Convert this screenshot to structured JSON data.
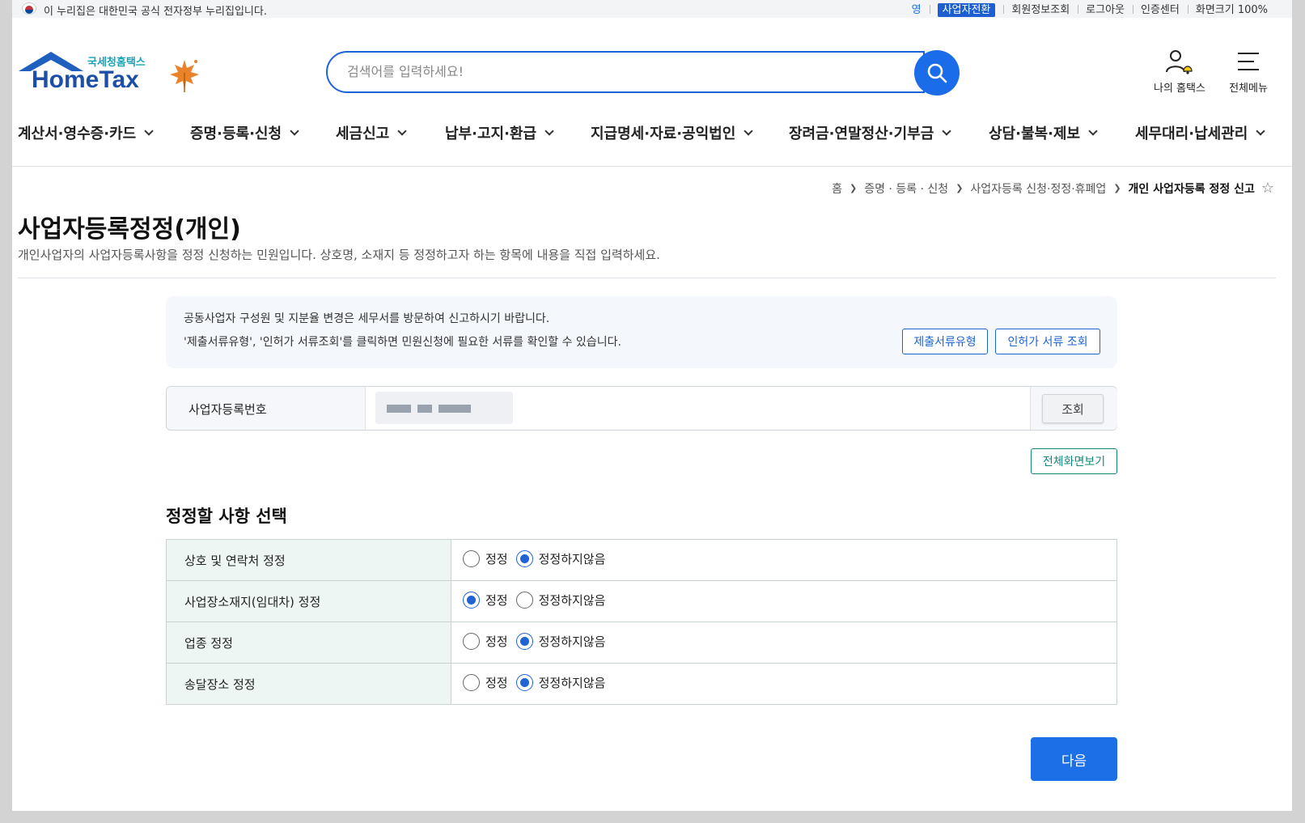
{
  "gov_banner": {
    "text": "이 누리집은 대한민국 공식 전자정부 누리집입니다.",
    "links": [
      {
        "label": "영"
      },
      {
        "label": "사업자전환"
      },
      {
        "label": "회원정보조회"
      },
      {
        "label": "로그아웃"
      },
      {
        "label": "인증센터"
      },
      {
        "label": "화면크기 100%"
      }
    ]
  },
  "header": {
    "org_name": "국세청홈택스",
    "brand": "HomeTax",
    "search_placeholder": "검색어를 입력하세요!",
    "my_hometax": "나의 홈택스",
    "all_menu": "전체메뉴"
  },
  "gnb": [
    {
      "label": "계산서·영수증·카드"
    },
    {
      "label": "증명·등록·신청"
    },
    {
      "label": "세금신고"
    },
    {
      "label": "납부·고지·환급"
    },
    {
      "label": "지급명세·자료·공익법인"
    },
    {
      "label": "장려금·연말정산·기부금"
    },
    {
      "label": "상담·불복·제보"
    },
    {
      "label": "세무대리·납세관리"
    }
  ],
  "breadcrumb": [
    "홈",
    "증명 · 등록 · 신청",
    "사업자등록 신청·정정·휴폐업",
    "개인 사업자등록 정정 신고"
  ],
  "page": {
    "title": "사업자등록정정(개인)",
    "description": "개인사업자의 사업자등록사항을 정정 신청하는 민원입니다. 상호명, 소재지 등 정정하고자 하는 항목에 내용을 직접 입력하세요."
  },
  "notice": {
    "line1": "공동사업자 구성원 및 지분율 변경은 세무서를 방문하여 신고하시기 바랍니다.",
    "line2": "'제출서류유형', '인허가 서류조회'를 클릭하면 민원신청에 필요한 서류를 확인할 수 있습니다.",
    "btn_doc_type": "제출서류유형",
    "btn_permit": "인허가 서류 조회"
  },
  "biz_number": {
    "label": "사업자등록번호",
    "btn_lookup": "조회"
  },
  "btn_fullscreen": "전체화면보기",
  "section_title": "정정할 사항 선택",
  "options": [
    {
      "label": "상호 및 연락처 정정",
      "opt_yes": "정정",
      "opt_no": "정정하지않음",
      "selected": "no"
    },
    {
      "label": "사업장소재지(임대차) 정정",
      "opt_yes": "정정",
      "opt_no": "정정하지않음",
      "selected": "yes"
    },
    {
      "label": "업종 정정",
      "opt_yes": "정정",
      "opt_no": "정정하지않음",
      "selected": "no"
    },
    {
      "label": "송달장소 정정",
      "opt_yes": "정정",
      "opt_no": "정정하지않음",
      "selected": "no"
    }
  ],
  "btn_next": "다음",
  "colors": {
    "primary": "#1d6fe8",
    "teal": "#12877a",
    "label_bg": "#eef6f4"
  }
}
